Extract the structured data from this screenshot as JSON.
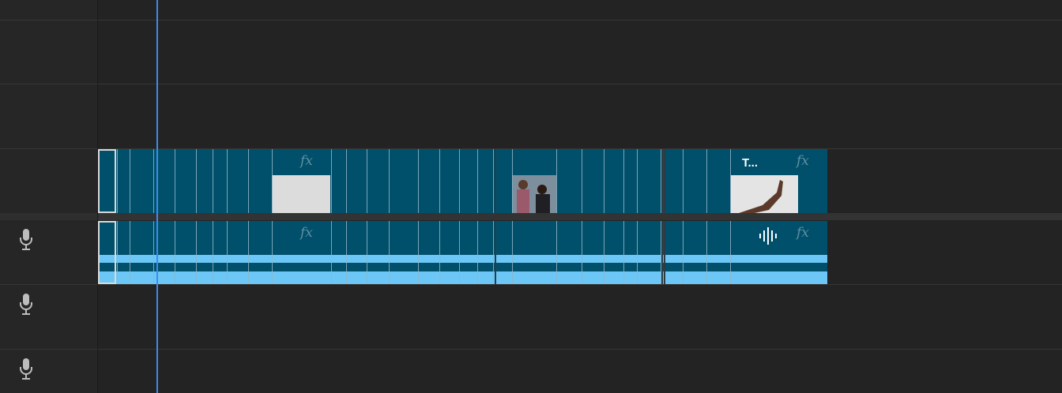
{
  "timeline": {
    "playhead_label": "playhead",
    "video_track": {
      "clips": [
        {
          "name": "clip-plain-fx",
          "fx": "fx"
        },
        {
          "name": "clip-people",
          "fx": ""
        },
        {
          "name": "clip-title",
          "title": "T...",
          "fx": "fx"
        }
      ]
    },
    "audio_track": {
      "fx_1": "fx",
      "fx_2": "fx"
    },
    "tracks": [
      {
        "type": "audio",
        "icon": "microphone-icon"
      },
      {
        "type": "audio",
        "icon": "microphone-icon"
      },
      {
        "type": "audio",
        "icon": "microphone-icon"
      }
    ]
  },
  "colors": {
    "clip_fill": "#00506b",
    "waveform": "#6cc7f6",
    "playhead": "#3a8cf0",
    "background": "#232323"
  }
}
